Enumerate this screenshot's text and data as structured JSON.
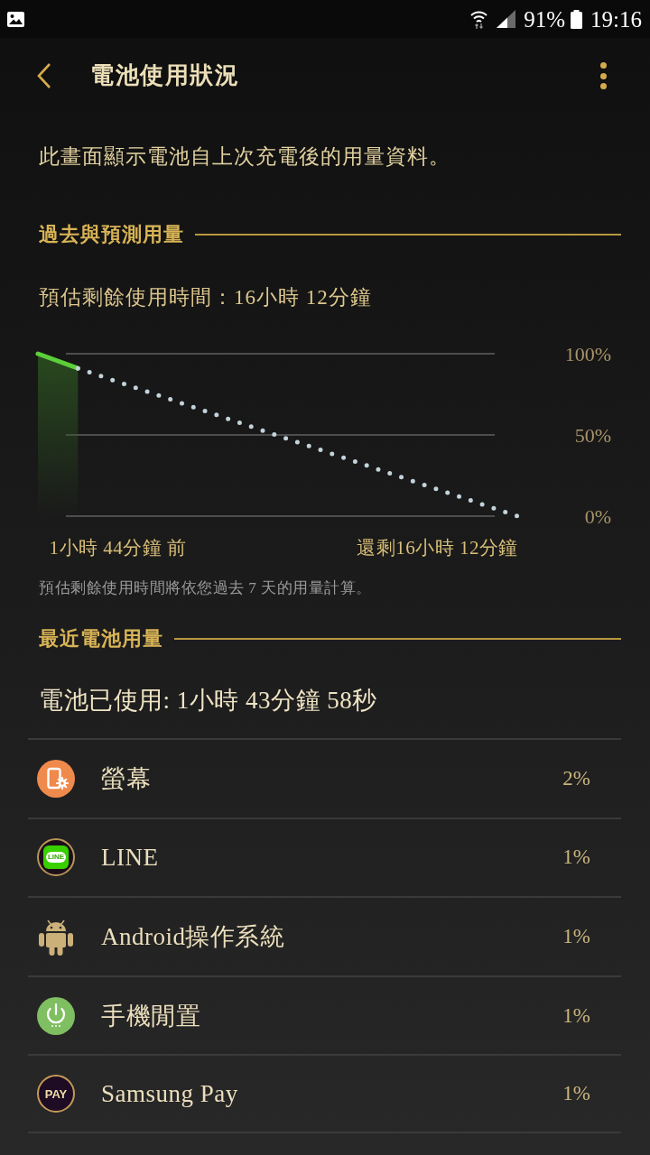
{
  "status_bar": {
    "battery_text": "91%",
    "time": "19:16"
  },
  "app_bar": {
    "title": "電池使用狀況"
  },
  "description": "此畫面顯示電池自上次充電後的用量資料。",
  "history_section": {
    "title": "過去與預測用量",
    "estimate": "預估剩餘使用時間：16小時 12分鐘",
    "chart_data": {
      "type": "line",
      "categories": [
        null,
        null,
        "1小時 44分鐘 前",
        null,
        null,
        null,
        null,
        null,
        null,
        null,
        "還剩16小時 12分鐘",
        null,
        null
      ],
      "ylim": [
        0,
        100
      ],
      "yticks": [
        {
          "value": 100,
          "label": "100%"
        },
        {
          "value": 50,
          "label": "50%"
        },
        {
          "value": 0,
          "label": "0%"
        }
      ],
      "series": [
        {
          "type": "area",
          "color": "#5ccf3a",
          "values": [
            100,
            91,
            null,
            null,
            null,
            null,
            null,
            null,
            null,
            null,
            null,
            null,
            null
          ]
        },
        {
          "color": "#c3d3da",
          "line_style": "dotted",
          "values": [
            null,
            91,
            82.7,
            74.5,
            66.2,
            57.9,
            49.6,
            41.4,
            33.1,
            24.8,
            16.5,
            8.3,
            0
          ]
        }
      ]
    },
    "note": "預估剩餘使用時間將依您過去 7 天的用量計算。"
  },
  "recent_section": {
    "title": "最近電池用量",
    "used": "電池已使用: 1小時 43分鐘 58秒",
    "apps": [
      {
        "kind": "screen",
        "name": "螢幕",
        "percent": "2%"
      },
      {
        "kind": "line",
        "name": "LINE",
        "percent": "1%",
        "icon_text": "LINE"
      },
      {
        "kind": "android",
        "name": "Android操作系統",
        "percent": "1%"
      },
      {
        "kind": "idle",
        "name": "手機閒置",
        "percent": "1%"
      },
      {
        "kind": "pay",
        "name": "Samsung Pay",
        "percent": "1%",
        "icon_text": "PAY"
      }
    ]
  }
}
